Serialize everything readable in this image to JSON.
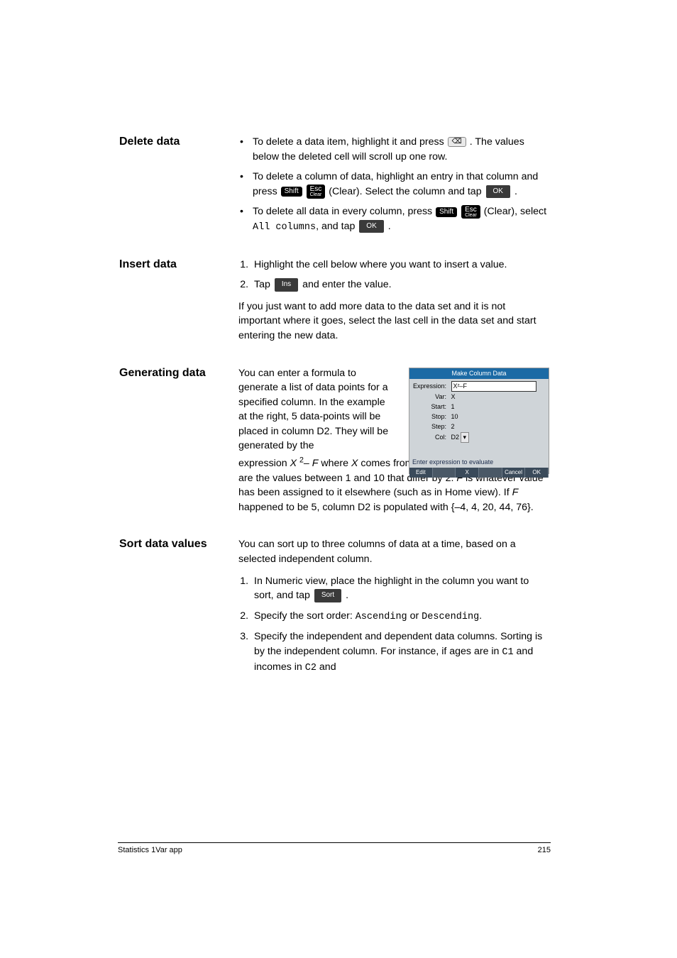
{
  "sections": {
    "delete": {
      "heading": "Delete data",
      "b1_a": "To delete a data item, highlight it and press ",
      "b1_b": ". The values below the deleted cell will scroll up one row.",
      "b2_a": "To delete a column of data, highlight an entry in that column and press ",
      "b2_b": " (Clear). Select the column and tap ",
      "b2_c": ".",
      "b3_a": "To delete all data in every column, press ",
      "b3_b": " (Clear), select ",
      "b3_code": "All columns",
      "b3_c": ", and tap ",
      "b3_d": "."
    },
    "insert": {
      "heading": "Insert data",
      "s1": "Highlight the cell below where you want to insert a value.",
      "s2_a": "Tap ",
      "s2_b": " and enter the value.",
      "p1": "If you just want to add more data to the data set and it is not important where it goes, select the last cell in the data set and start entering the new data."
    },
    "generating": {
      "heading": "Generating data",
      "left": "You can enter a formula to generate a list of data points for a specified column. In the example at the right, 5 data-points will be placed in column D2. They will be generated by the",
      "rest_a": "expression ",
      "rest_x2": "X",
      "rest_exp": "2",
      "rest_b": "– ",
      "rest_f": "F",
      "rest_c": " where ",
      "rest_x": "X",
      "rest_d": " comes from the set {1, 3, 5, 7, 9}. These are the values between 1 and 10 that differ by 2. ",
      "rest_f2": "F",
      "rest_e": " is whatever value has been assigned to it elsewhere (such as in Home view). If ",
      "rest_f3": "F",
      "rest_g": " happened to be 5, column D2 is populated with {–4, 4, 20, 44, 76}.",
      "figure": {
        "title": "Make Column Data",
        "expr_label": "Expression:",
        "expr_val": "X²–F",
        "var_label": "Var:",
        "var_val": "X",
        "start_label": "Start:",
        "start_val": "1",
        "stop_label": "Stop:",
        "stop_val": "10",
        "step_label": "Step:",
        "step_val": "2",
        "col_label": "Col:",
        "col_val": "D2",
        "hint": "Enter expression to evaluate",
        "sk1": "Edit",
        "sk2": "X",
        "sk3": "Cancel",
        "sk4": "OK"
      }
    },
    "sort": {
      "heading": "Sort data values",
      "p1": "You can sort up to three columns of data at a time, based on a selected independent column.",
      "s1_a": "In Numeric view, place the highlight in the column you want to sort, and tap ",
      "s1_b": ".",
      "s2_a": "Specify the sort order: ",
      "s2_asc": "Ascending",
      "s2_or": " or ",
      "s2_desc": "Descending",
      "s2_b": ".",
      "s3_a": "Specify the independent and dependent data columns. Sorting is by the independent column. For instance, if ages are in ",
      "s3_c1": "C1",
      "s3_b": " and incomes in ",
      "s3_c2": "C2",
      "s3_c": " and"
    }
  },
  "keys": {
    "del_glyph": "⌫",
    "shift": "Shift",
    "esc": "Esc",
    "esc_sub": "Clear",
    "ok": "OK",
    "ins": "Ins",
    "sort": "Sort"
  },
  "footer": {
    "left": "Statistics 1Var app",
    "right": "215"
  }
}
